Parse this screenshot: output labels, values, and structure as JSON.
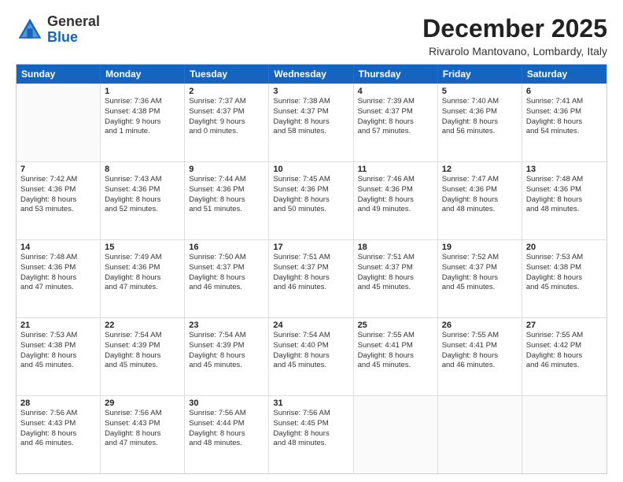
{
  "header": {
    "logo_general": "General",
    "logo_blue": "Blue",
    "month": "December 2025",
    "location": "Rivarolo Mantovano, Lombardy, Italy"
  },
  "weekdays": [
    "Sunday",
    "Monday",
    "Tuesday",
    "Wednesday",
    "Thursday",
    "Friday",
    "Saturday"
  ],
  "rows": [
    [
      {
        "day": "",
        "lines": []
      },
      {
        "day": "1",
        "lines": [
          "Sunrise: 7:36 AM",
          "Sunset: 4:38 PM",
          "Daylight: 9 hours",
          "and 1 minute."
        ]
      },
      {
        "day": "2",
        "lines": [
          "Sunrise: 7:37 AM",
          "Sunset: 4:37 PM",
          "Daylight: 9 hours",
          "and 0 minutes."
        ]
      },
      {
        "day": "3",
        "lines": [
          "Sunrise: 7:38 AM",
          "Sunset: 4:37 PM",
          "Daylight: 8 hours",
          "and 58 minutes."
        ]
      },
      {
        "day": "4",
        "lines": [
          "Sunrise: 7:39 AM",
          "Sunset: 4:37 PM",
          "Daylight: 8 hours",
          "and 57 minutes."
        ]
      },
      {
        "day": "5",
        "lines": [
          "Sunrise: 7:40 AM",
          "Sunset: 4:36 PM",
          "Daylight: 8 hours",
          "and 56 minutes."
        ]
      },
      {
        "day": "6",
        "lines": [
          "Sunrise: 7:41 AM",
          "Sunset: 4:36 PM",
          "Daylight: 8 hours",
          "and 54 minutes."
        ]
      }
    ],
    [
      {
        "day": "7",
        "lines": [
          "Sunrise: 7:42 AM",
          "Sunset: 4:36 PM",
          "Daylight: 8 hours",
          "and 53 minutes."
        ]
      },
      {
        "day": "8",
        "lines": [
          "Sunrise: 7:43 AM",
          "Sunset: 4:36 PM",
          "Daylight: 8 hours",
          "and 52 minutes."
        ]
      },
      {
        "day": "9",
        "lines": [
          "Sunrise: 7:44 AM",
          "Sunset: 4:36 PM",
          "Daylight: 8 hours",
          "and 51 minutes."
        ]
      },
      {
        "day": "10",
        "lines": [
          "Sunrise: 7:45 AM",
          "Sunset: 4:36 PM",
          "Daylight: 8 hours",
          "and 50 minutes."
        ]
      },
      {
        "day": "11",
        "lines": [
          "Sunrise: 7:46 AM",
          "Sunset: 4:36 PM",
          "Daylight: 8 hours",
          "and 49 minutes."
        ]
      },
      {
        "day": "12",
        "lines": [
          "Sunrise: 7:47 AM",
          "Sunset: 4:36 PM",
          "Daylight: 8 hours",
          "and 48 minutes."
        ]
      },
      {
        "day": "13",
        "lines": [
          "Sunrise: 7:48 AM",
          "Sunset: 4:36 PM",
          "Daylight: 8 hours",
          "and 48 minutes."
        ]
      }
    ],
    [
      {
        "day": "14",
        "lines": [
          "Sunrise: 7:48 AM",
          "Sunset: 4:36 PM",
          "Daylight: 8 hours",
          "and 47 minutes."
        ]
      },
      {
        "day": "15",
        "lines": [
          "Sunrise: 7:49 AM",
          "Sunset: 4:36 PM",
          "Daylight: 8 hours",
          "and 47 minutes."
        ]
      },
      {
        "day": "16",
        "lines": [
          "Sunrise: 7:50 AM",
          "Sunset: 4:37 PM",
          "Daylight: 8 hours",
          "and 46 minutes."
        ]
      },
      {
        "day": "17",
        "lines": [
          "Sunrise: 7:51 AM",
          "Sunset: 4:37 PM",
          "Daylight: 8 hours",
          "and 46 minutes."
        ]
      },
      {
        "day": "18",
        "lines": [
          "Sunrise: 7:51 AM",
          "Sunset: 4:37 PM",
          "Daylight: 8 hours",
          "and 45 minutes."
        ]
      },
      {
        "day": "19",
        "lines": [
          "Sunrise: 7:52 AM",
          "Sunset: 4:37 PM",
          "Daylight: 8 hours",
          "and 45 minutes."
        ]
      },
      {
        "day": "20",
        "lines": [
          "Sunrise: 7:53 AM",
          "Sunset: 4:38 PM",
          "Daylight: 8 hours",
          "and 45 minutes."
        ]
      }
    ],
    [
      {
        "day": "21",
        "lines": [
          "Sunrise: 7:53 AM",
          "Sunset: 4:38 PM",
          "Daylight: 8 hours",
          "and 45 minutes."
        ]
      },
      {
        "day": "22",
        "lines": [
          "Sunrise: 7:54 AM",
          "Sunset: 4:39 PM",
          "Daylight: 8 hours",
          "and 45 minutes."
        ]
      },
      {
        "day": "23",
        "lines": [
          "Sunrise: 7:54 AM",
          "Sunset: 4:39 PM",
          "Daylight: 8 hours",
          "and 45 minutes."
        ]
      },
      {
        "day": "24",
        "lines": [
          "Sunrise: 7:54 AM",
          "Sunset: 4:40 PM",
          "Daylight: 8 hours",
          "and 45 minutes."
        ]
      },
      {
        "day": "25",
        "lines": [
          "Sunrise: 7:55 AM",
          "Sunset: 4:41 PM",
          "Daylight: 8 hours",
          "and 45 minutes."
        ]
      },
      {
        "day": "26",
        "lines": [
          "Sunrise: 7:55 AM",
          "Sunset: 4:41 PM",
          "Daylight: 8 hours",
          "and 46 minutes."
        ]
      },
      {
        "day": "27",
        "lines": [
          "Sunrise: 7:55 AM",
          "Sunset: 4:42 PM",
          "Daylight: 8 hours",
          "and 46 minutes."
        ]
      }
    ],
    [
      {
        "day": "28",
        "lines": [
          "Sunrise: 7:56 AM",
          "Sunset: 4:43 PM",
          "Daylight: 8 hours",
          "and 46 minutes."
        ]
      },
      {
        "day": "29",
        "lines": [
          "Sunrise: 7:56 AM",
          "Sunset: 4:43 PM",
          "Daylight: 8 hours",
          "and 47 minutes."
        ]
      },
      {
        "day": "30",
        "lines": [
          "Sunrise: 7:56 AM",
          "Sunset: 4:44 PM",
          "Daylight: 8 hours",
          "and 48 minutes."
        ]
      },
      {
        "day": "31",
        "lines": [
          "Sunrise: 7:56 AM",
          "Sunset: 4:45 PM",
          "Daylight: 8 hours",
          "and 48 minutes."
        ]
      },
      {
        "day": "",
        "lines": []
      },
      {
        "day": "",
        "lines": []
      },
      {
        "day": "",
        "lines": []
      }
    ]
  ]
}
